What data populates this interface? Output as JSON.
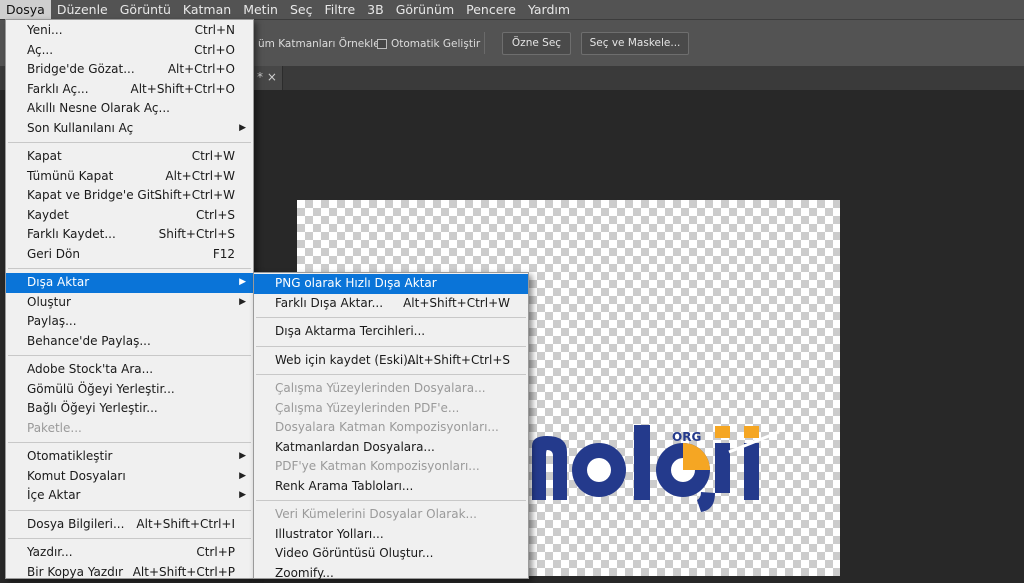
{
  "menubar": {
    "items": [
      "Dosya",
      "Düzenle",
      "Görüntü",
      "Katman",
      "Metin",
      "Seç",
      "Filtre",
      "3B",
      "Görünüm",
      "Pencere",
      "Yardım"
    ]
  },
  "options_bar": {
    "sample_label": "üm Katmanları Örnekle",
    "auto_enhance_label": "Otomatik Geliştir",
    "select_subject": "Özne Seç",
    "select_mask": "Seç ve Maskele..."
  },
  "tab": {
    "modified_mark": "* ×"
  },
  "file_menu": {
    "groups": [
      [
        {
          "label": "Yeni...",
          "shortcut": "Ctrl+N"
        },
        {
          "label": "Aç...",
          "shortcut": "Ctrl+O"
        },
        {
          "label": "Bridge'de Gözat...",
          "shortcut": "Alt+Ctrl+O"
        },
        {
          "label": "Farklı Aç...",
          "shortcut": "Alt+Shift+Ctrl+O"
        },
        {
          "label": "Akıllı Nesne Olarak Aç..."
        },
        {
          "label": "Son Kullanılanı Aç",
          "submenu": true
        }
      ],
      [
        {
          "label": "Kapat",
          "shortcut": "Ctrl+W"
        },
        {
          "label": "Tümünü Kapat",
          "shortcut": "Alt+Ctrl+W"
        },
        {
          "label": "Kapat ve Bridge'e Git...",
          "shortcut": "Shift+Ctrl+W"
        },
        {
          "label": "Kaydet",
          "shortcut": "Ctrl+S"
        },
        {
          "label": "Farklı Kaydet...",
          "shortcut": "Shift+Ctrl+S"
        },
        {
          "label": "Geri Dön",
          "shortcut": "F12"
        }
      ],
      [
        {
          "label": "Dışa Aktar",
          "submenu": true,
          "highlight": true
        },
        {
          "label": "Oluştur",
          "submenu": true
        },
        {
          "label": "Paylaş..."
        },
        {
          "label": "Behance'de Paylaş..."
        }
      ],
      [
        {
          "label": "Adobe Stock'ta Ara..."
        },
        {
          "label": "Gömülü Öğeyi Yerleştir..."
        },
        {
          "label": "Bağlı Öğeyi Yerleştir..."
        },
        {
          "label": "Paketle...",
          "disabled": true
        }
      ],
      [
        {
          "label": "Otomatikleştir",
          "submenu": true
        },
        {
          "label": "Komut Dosyaları",
          "submenu": true
        },
        {
          "label": "İçe Aktar",
          "submenu": true
        }
      ],
      [
        {
          "label": "Dosya Bilgileri...",
          "shortcut": "Alt+Shift+Ctrl+I"
        }
      ],
      [
        {
          "label": "Yazdır...",
          "shortcut": "Ctrl+P"
        },
        {
          "label": "Bir Kopya Yazdır",
          "shortcut": "Alt+Shift+Ctrl+P"
        }
      ]
    ]
  },
  "export_submenu": {
    "groups": [
      [
        {
          "label": "PNG olarak Hızlı Dışa Aktar",
          "highlight": true
        },
        {
          "label": "Farklı Dışa Aktar...",
          "shortcut": "Alt+Shift+Ctrl+W"
        }
      ],
      [
        {
          "label": "Dışa Aktarma Tercihleri..."
        }
      ],
      [
        {
          "label": "Web için kaydet (Eski)...",
          "shortcut": "Alt+Shift+Ctrl+S"
        }
      ],
      [
        {
          "label": "Çalışma Yüzeylerinden Dosyalara...",
          "disabled": true
        },
        {
          "label": "Çalışma Yüzeylerinden PDF'e...",
          "disabled": true
        },
        {
          "label": "Dosyalara Katman Kompozisyonları...",
          "disabled": true
        },
        {
          "label": "Katmanlardan Dosyalara..."
        },
        {
          "label": "PDF'ye Katman Kompozisyonları...",
          "disabled": true
        },
        {
          "label": "Renk Arama Tabloları..."
        }
      ],
      [
        {
          "label": "Veri Kümelerini Dosyalar Olarak...",
          "disabled": true
        },
        {
          "label": "Illustrator Yolları..."
        },
        {
          "label": "Video Görüntüsü Oluştur..."
        },
        {
          "label": "Zoomify..."
        }
      ]
    ]
  },
  "logo": {
    "text": "noloji",
    "superscript": "ORG",
    "colors": {
      "blue": "#243a8c",
      "orange": "#f5a623"
    }
  }
}
